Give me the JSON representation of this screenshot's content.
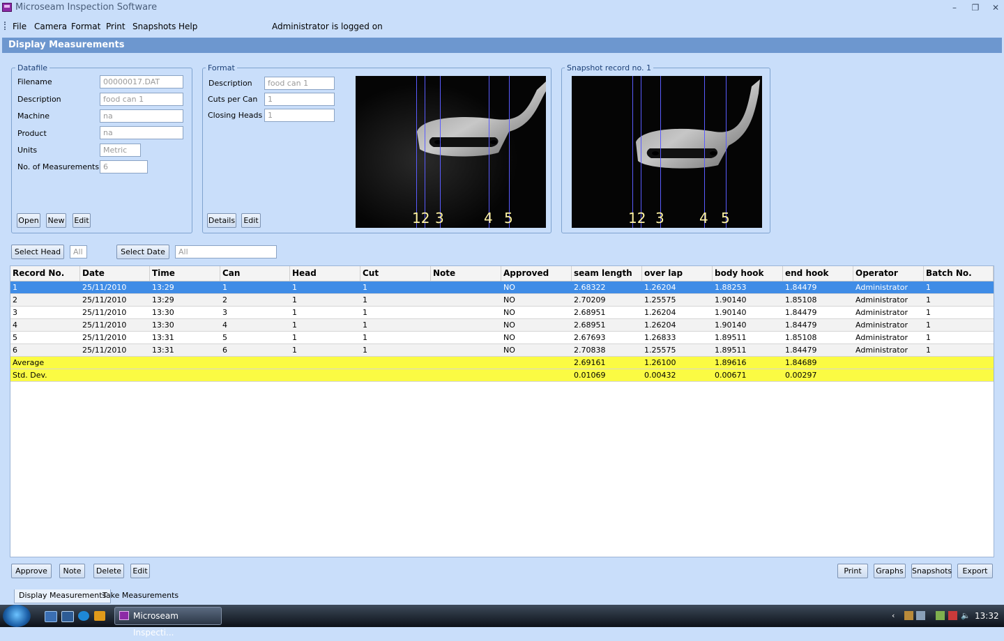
{
  "window": {
    "title": "Microseam Inspection Software"
  },
  "menu": {
    "items": [
      "File",
      "Camera",
      "Format",
      "Print",
      "Snapshots",
      "Help"
    ],
    "status": "Administrator is logged on"
  },
  "header": {
    "title": "Display Measurements"
  },
  "datafile": {
    "title": "Datafile",
    "filename_label": "Filename",
    "filename": "00000017.DAT",
    "description_label": "Description",
    "description": "food can 1",
    "machine_label": "Machine",
    "machine": "na",
    "product_label": "Product",
    "product": "na",
    "units_label": "Units",
    "units": "Metric",
    "measurements_label": "No. of Measurements",
    "measurements": "6",
    "buttons": {
      "open": "Open",
      "new": "New",
      "edit": "Edit"
    }
  },
  "format": {
    "title": "Format",
    "description_label": "Description",
    "description": "food can 1",
    "cuts_label": "Cuts per Can",
    "cuts": "1",
    "heads_label": "Closing Heads",
    "heads": "1",
    "buttons": {
      "details": "Details",
      "edit": "Edit"
    },
    "image_labels": {
      "l12": "12",
      "l3": "3",
      "l4": "4",
      "l5": "5"
    }
  },
  "snapshot": {
    "title": "Snapshot record no. 1",
    "image_labels": {
      "l12": "12",
      "l3": "3",
      "l4": "4",
      "l5": "5"
    }
  },
  "filters": {
    "select_head": "Select Head",
    "head_value": "All",
    "select_date": "Select Date",
    "date_value": "All"
  },
  "table": {
    "columns": [
      "Record No.",
      "Date",
      "Time",
      "Can",
      "Head",
      "Cut",
      "Note",
      "Approved",
      "seam length",
      "over lap",
      "body hook",
      "end hook",
      "Operator",
      "Batch No."
    ],
    "rows": [
      [
        "1",
        "25/11/2010",
        "13:29",
        "1",
        "1",
        "1",
        "",
        "NO",
        "2.68322",
        "1.26204",
        "1.88253",
        "1.84479",
        "Administrator",
        "1"
      ],
      [
        "2",
        "25/11/2010",
        "13:29",
        "2",
        "1",
        "1",
        "",
        "NO",
        "2.70209",
        "1.25575",
        "1.90140",
        "1.85108",
        "Administrator",
        "1"
      ],
      [
        "3",
        "25/11/2010",
        "13:30",
        "3",
        "1",
        "1",
        "",
        "NO",
        "2.68951",
        "1.26204",
        "1.90140",
        "1.84479",
        "Administrator",
        "1"
      ],
      [
        "4",
        "25/11/2010",
        "13:30",
        "4",
        "1",
        "1",
        "",
        "NO",
        "2.68951",
        "1.26204",
        "1.90140",
        "1.84479",
        "Administrator",
        "1"
      ],
      [
        "5",
        "25/11/2010",
        "13:31",
        "5",
        "1",
        "1",
        "",
        "NO",
        "2.67693",
        "1.26833",
        "1.89511",
        "1.85108",
        "Administrator",
        "1"
      ],
      [
        "6",
        "25/11/2010",
        "13:31",
        "6",
        "1",
        "1",
        "",
        "NO",
        "2.70838",
        "1.25575",
        "1.89511",
        "1.84479",
        "Administrator",
        "1"
      ]
    ],
    "stats": [
      [
        "Average",
        "2.69161",
        "1.26100",
        "1.89616",
        "1.84689"
      ],
      [
        "Std. Dev.",
        "0.01069",
        "0.00432",
        "0.00671",
        "0.00297"
      ]
    ]
  },
  "actions": {
    "approve": "Approve",
    "note": "Note",
    "delete": "Delete",
    "edit": "Edit",
    "print": "Print",
    "graphs": "Graphs",
    "snapshots": "Snapshots",
    "export": "Export"
  },
  "tabs": [
    "Display Measurements",
    "Take Measurements"
  ],
  "taskbar": {
    "task": "Microseam Inspecti...",
    "clock": "13:32"
  },
  "colors": {
    "selected_row": "#3f8ce6",
    "stat_row": "#fbfb43",
    "header_strip": "#6d97cf",
    "background": "#c9defa"
  }
}
